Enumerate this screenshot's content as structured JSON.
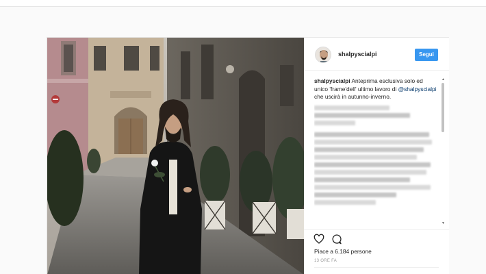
{
  "post": {
    "username": "shalpyscialpi",
    "follow_label": "Segui",
    "caption": {
      "username": "shalpyscialpi",
      "text": " Anteprima esclusiva solo ed unico 'frame'dell' ultimo lavoro di ",
      "mention": "@shalpyscialpi",
      "text_after": " che uscirà in autunno-inverno."
    },
    "likes": "Piace a 6.184 persone",
    "timestamp": "13 ORE FA"
  },
  "icons": {
    "like": "heart-icon",
    "comment": "comment-bubble-icon",
    "scroll_up": "arrow-up-icon",
    "scroll_down": "arrow-down-icon"
  },
  "colors": {
    "follow_button": "#3897f0",
    "mention": "#003569",
    "timestamp": "#999999"
  }
}
